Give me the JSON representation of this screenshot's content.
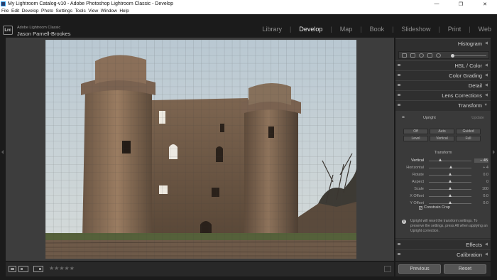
{
  "window": {
    "title": "My Lightroom Catalog-v10 - Adobe Photoshop Lightroom Classic - Develop",
    "minimize_glyph": "—",
    "restore_glyph": "❐",
    "close_glyph": "✕"
  },
  "menu": [
    "File",
    "Edit",
    "Develop",
    "Photo",
    "Settings",
    "Tools",
    "View",
    "Window",
    "Help"
  ],
  "identity": {
    "logo_text": "Lrc",
    "product": "Adobe Lightroom Classic",
    "user": "Jason Parnell-Brookes"
  },
  "modules": {
    "items": [
      "Library",
      "Develop",
      "Map",
      "Book",
      "Slideshow",
      "Print",
      "Web"
    ],
    "active": "Develop",
    "separator": "|"
  },
  "panel": {
    "histogram": "Histogram",
    "hsl": "HSL / Color",
    "color_grading": "Color Grading",
    "detail": "Detail",
    "lens_corrections": "Lens Corrections",
    "transform": "Transform",
    "effects": "Effects",
    "calibration": "Calibration",
    "collapsed_glyph": "◀",
    "expanded_glyph": "▼"
  },
  "transform": {
    "crop_icon": "⌗",
    "upright_label": "Upright",
    "update_label": "Update",
    "upright_buttons": [
      "Off",
      "Auto",
      "Guided",
      "Level",
      "Vertical",
      "Full"
    ],
    "section_label": "Transform",
    "sliders": [
      {
        "name": "Vertical",
        "value": "− 45",
        "position": 0.28,
        "active": true
      },
      {
        "name": "Horizontal",
        "value": "+ 4",
        "position": 0.52,
        "active": false
      },
      {
        "name": "Rotate",
        "value": "0.0",
        "position": 0.5,
        "active": false
      },
      {
        "name": "Aspect",
        "value": "0",
        "position": 0.5,
        "active": false
      },
      {
        "name": "Scale",
        "value": "100",
        "position": 0.5,
        "active": false
      },
      {
        "name": "X Offset",
        "value": "0.0",
        "position": 0.5,
        "active": false
      },
      {
        "name": "Y Offset",
        "value": "0.0",
        "position": 0.5,
        "active": false
      }
    ],
    "constrain_crop": "Constrain Crop",
    "constrain_checked": "✓",
    "info_glyph": "i",
    "notice": "Upright will reset the transform settings. To preserve the settings, press Alt when applying an Upright correction."
  },
  "toolbar": {
    "stars": "★★★★★",
    "stars_color": "#6a6a6a"
  },
  "footer": {
    "previous": "Previous",
    "reset": "Reset"
  },
  "colors": {
    "panel_bg": "#2f2f2f",
    "canvas_bg": "#3d3d3d",
    "active_module": "#f2f2f2",
    "inactive_module": "#8e8e8e"
  }
}
